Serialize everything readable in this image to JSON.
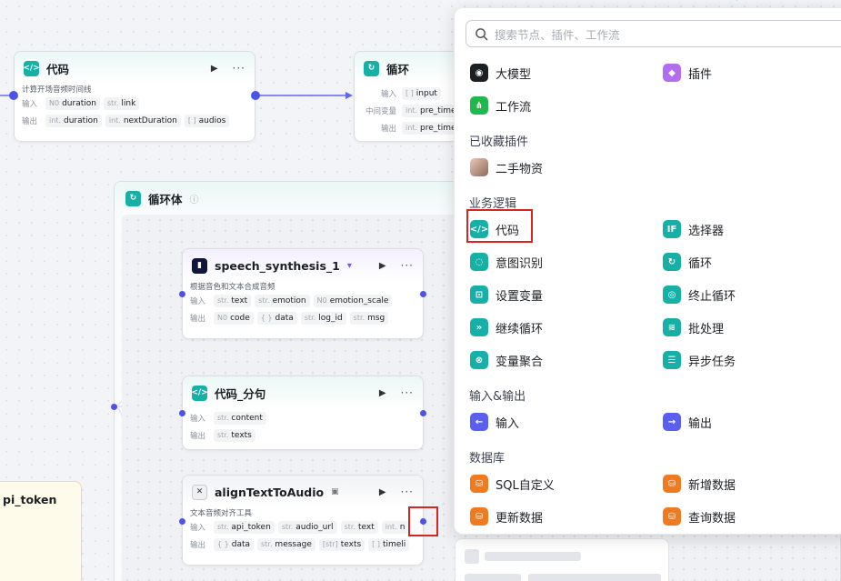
{
  "nodes": {
    "code_top": {
      "title": "代码",
      "desc": "计算开场音频时间线",
      "input_label": "输入",
      "output_label": "输出",
      "inputs": [
        {
          "type": "N0",
          "name": "duration"
        },
        {
          "type": "str.",
          "name": "link"
        }
      ],
      "outputs": [
        {
          "type": "int.",
          "name": "duration"
        },
        {
          "type": "int.",
          "name": "nextDuration"
        },
        {
          "type": "[ ]",
          "name": "audios"
        }
      ]
    },
    "loop": {
      "title": "循环",
      "input_label": "输入",
      "var_label": "中间变量",
      "output_label": "输出",
      "input": {
        "type": "[ ]",
        "name": "input"
      },
      "var": {
        "type": "int.",
        "name": "pre_time"
      },
      "output": {
        "type": "int.",
        "name": "pre_time"
      }
    },
    "loop_body": {
      "title": "循环体",
      "info_icon": "ⓘ"
    },
    "speech": {
      "title": "speech_synthesis_1",
      "desc": "根据音色和文本合成音频",
      "input_label": "输入",
      "output_label": "输出",
      "inputs": [
        {
          "type": "str.",
          "name": "text"
        },
        {
          "type": "str.",
          "name": "emotion"
        },
        {
          "type": "N0",
          "name": "emotion_scale"
        }
      ],
      "outputs": [
        {
          "type": "N0",
          "name": "code"
        },
        {
          "type": "{ }",
          "name": "data"
        },
        {
          "type": "str.",
          "name": "log_id"
        },
        {
          "type": "str.",
          "name": "msg"
        }
      ]
    },
    "split": {
      "title": "代码_分句",
      "input_label": "输入",
      "output_label": "输出",
      "input": {
        "type": "str.",
        "name": "content"
      },
      "output": {
        "type": "str.",
        "name": "texts"
      }
    },
    "align": {
      "title": "alignTextToAudio",
      "desc": "文本音频对齐工具",
      "input_label": "输入",
      "output_label": "输出",
      "inputs": [
        {
          "type": "str.",
          "name": "api_token"
        },
        {
          "type": "str.",
          "name": "audio_url"
        },
        {
          "type": "str.",
          "name": "text"
        },
        {
          "type": "int.",
          "name": "n"
        }
      ],
      "outputs": [
        {
          "type": "{ }",
          "name": "data"
        },
        {
          "type": "str.",
          "name": "message"
        },
        {
          "type": "[str]",
          "name": "texts"
        },
        {
          "type": "[ ]",
          "name": "timeli"
        }
      ]
    },
    "left_card": {
      "title": "pi_token"
    }
  },
  "controls": {
    "run": "▶",
    "more": "···"
  },
  "panel": {
    "search_placeholder": "搜索节点、插件、工作流",
    "top_items": [
      {
        "label": "大模型",
        "icon": "llm-icon",
        "color": "#1c1f23"
      },
      {
        "label": "插件",
        "icon": "plugin-icon",
        "color": "#b36ef0"
      },
      {
        "label": "工作流",
        "icon": "workflow-icon",
        "color": "#1fb84d"
      }
    ],
    "sections": {
      "saved": "已收藏插件",
      "logic": "业务逻辑",
      "io": "输入&输出",
      "db": "数据库"
    },
    "saved_items": [
      {
        "label": "二手物资",
        "icon": "avatar-icon"
      }
    ],
    "logic_items": [
      {
        "label": "代码",
        "icon": "code-icon",
        "color": "#17b0a6"
      },
      {
        "label": "选择器",
        "icon": "selector-icon",
        "color": "#17b0a6"
      },
      {
        "label": "意图识别",
        "icon": "intent-icon",
        "color": "#17b0a6"
      },
      {
        "label": "循环",
        "icon": "loop-icon",
        "color": "#17b0a6"
      },
      {
        "label": "设置变量",
        "icon": "set-variable-icon",
        "color": "#17b0a6"
      },
      {
        "label": "终止循环",
        "icon": "stop-loop-icon",
        "color": "#17b0a6"
      },
      {
        "label": "继续循环",
        "icon": "continue-loop-icon",
        "color": "#17b0a6"
      },
      {
        "label": "批处理",
        "icon": "batch-icon",
        "color": "#17b0a6"
      },
      {
        "label": "变量聚合",
        "icon": "aggregate-icon",
        "color": "#17b0a6"
      },
      {
        "label": "异步任务",
        "icon": "async-task-icon",
        "color": "#17b0a6"
      }
    ],
    "io_items": [
      {
        "label": "输入",
        "icon": "input-icon",
        "color": "#5b5ff0"
      },
      {
        "label": "输出",
        "icon": "output-icon",
        "color": "#5b5ff0"
      }
    ],
    "db_items": [
      {
        "label": "SQL自定义",
        "icon": "sql-icon",
        "color": "#f07a1f"
      },
      {
        "label": "新增数据",
        "icon": "add-data-icon",
        "color": "#f07a1f"
      },
      {
        "label": "更新数据",
        "icon": "update-data-icon",
        "color": "#f07a1f"
      },
      {
        "label": "查询数据",
        "icon": "query-data-icon",
        "color": "#f07a1f"
      }
    ]
  },
  "colors": {
    "wire": "#5b5ff0",
    "accent": "#17b0a6",
    "highlight": "#d9251d"
  }
}
